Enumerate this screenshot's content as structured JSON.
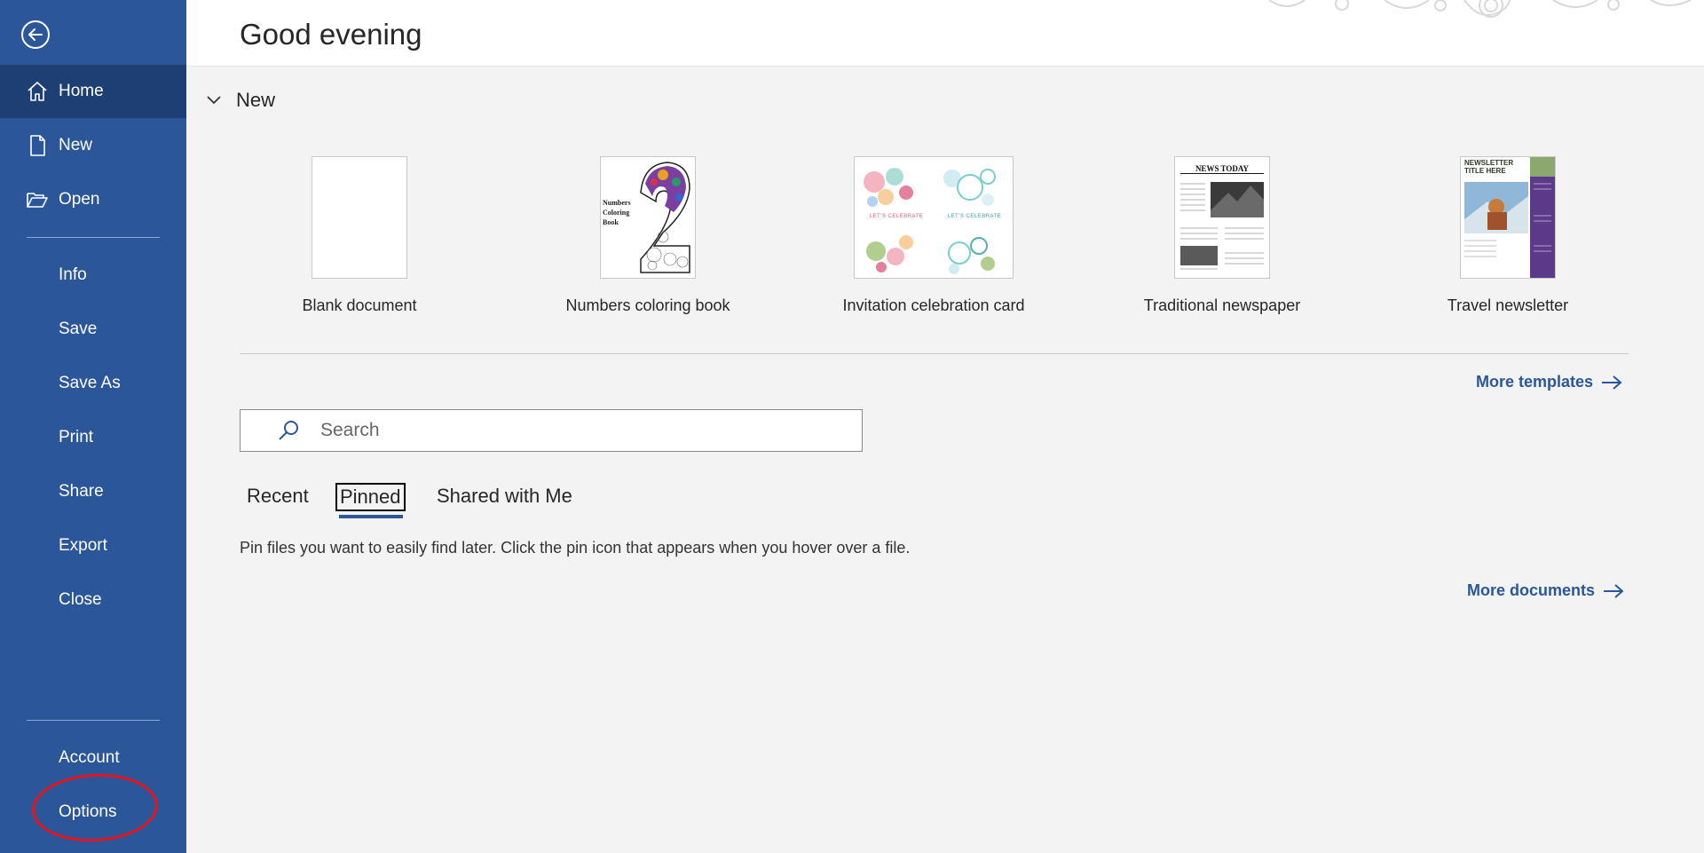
{
  "sidebar": {
    "items": [
      {
        "label": "Home"
      },
      {
        "label": "New"
      },
      {
        "label": "Open"
      },
      {
        "label": "Info"
      },
      {
        "label": "Save"
      },
      {
        "label": "Save As"
      },
      {
        "label": "Print"
      },
      {
        "label": "Share"
      },
      {
        "label": "Export"
      },
      {
        "label": "Close"
      },
      {
        "label": "Account"
      },
      {
        "label": "Options"
      }
    ],
    "active": "Home",
    "accent": "#2b579a",
    "active_bg": "#1e3f73",
    "highlight_color": "#e8141c"
  },
  "header": {
    "greeting": "Good evening"
  },
  "new_section": {
    "label": "New",
    "templates": [
      {
        "name": "Blank document"
      },
      {
        "name": "Numbers coloring book",
        "thumb_text": "Numbers Coloring Book"
      },
      {
        "name": "Invitation celebration card",
        "thumb_text": "LET'S CELEBRATE"
      },
      {
        "name": "Traditional newspaper",
        "thumb_text": "NEWS TODAY"
      },
      {
        "name": "Travel newsletter",
        "thumb_text": "NEWSLETTER TITLE HERE"
      }
    ],
    "more_templates": "More templates"
  },
  "search": {
    "placeholder": "Search"
  },
  "tabs": [
    {
      "label": "Recent"
    },
    {
      "label": "Pinned"
    },
    {
      "label": "Shared with Me"
    }
  ],
  "active_tab": "Pinned",
  "pinned_message": "Pin files you want to easily find later. Click the pin icon that appears when you hover over a file.",
  "more_documents": "More documents"
}
